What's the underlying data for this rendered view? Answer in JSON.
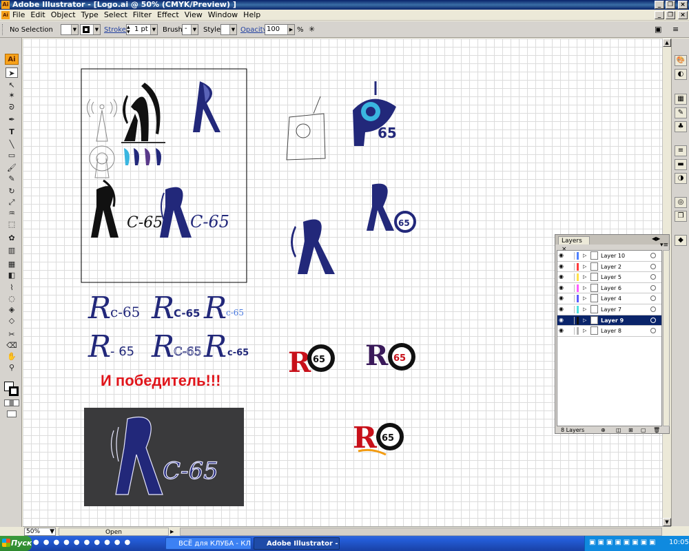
{
  "window": {
    "title": "Adobe Illustrator - [Logo.ai @ 50% (CMYK/Preview) ]",
    "app_icon": "Ai",
    "doc_icon": "Ai"
  },
  "menu": [
    "File",
    "Edit",
    "Object",
    "Type",
    "Select",
    "Filter",
    "Effect",
    "View",
    "Window",
    "Help"
  ],
  "control_bar": {
    "selection": "No Selection",
    "stroke_label": "Stroke:",
    "stroke_value": "1 pt",
    "brush_label": "Brush:",
    "brush_value": "-",
    "style_label": "Style:",
    "opacity_label": "Opacity:",
    "opacity_value": "100",
    "opacity_unit": "%"
  },
  "tools": {
    "badge": "Ai",
    "icons": [
      "selection-tool",
      "direct-selection-tool",
      "magic-wand-tool",
      "lasso-tool",
      "pen-tool",
      "type-tool",
      "line-tool",
      "rectangle-tool",
      "paintbrush-tool",
      "pencil-tool",
      "rotate-tool",
      "scale-tool",
      "warp-tool",
      "free-transform-tool",
      "symbol-sprayer-tool",
      "column-graph-tool",
      "mesh-tool",
      "gradient-tool",
      "eyedropper-tool",
      "blend-tool",
      "live-paint-tool",
      "live-paint-selection-tool",
      "slice-tool",
      "eraser-tool",
      "scissors-tool",
      "hand-tool",
      "zoom-tool"
    ]
  },
  "artwork": {
    "caption": "И победитель!!!",
    "caption_color": "#e0151b",
    "logo_text_a": "C-65",
    "logo_text_b": "C-65",
    "logo_text_c": "c-65",
    "logo_text_d": "c-65",
    "logo_text_e": "C-65",
    "logo_text_f": "c-65",
    "logo_text_g": "c-65",
    "logo_text_h": "- 65",
    "logo_text_i": "c-65",
    "logo_text_j": "c-65",
    "logo_text_k": "C-65",
    "badge_num": "65",
    "badge_num_2": "65",
    "badge_num_3": "65",
    "badge_num_4": "65",
    "badge_num_5": "65",
    "badge_num_6": "65",
    "dark_logo_text": "C-65",
    "navy": "#22287a",
    "dark_bg": "#3a3a3c"
  },
  "layers_panel": {
    "tab": "Layers",
    "layers": [
      {
        "name": "Layer 10",
        "color": "#4f81ff"
      },
      {
        "name": "Layer 2",
        "color": "#ff3b3b"
      },
      {
        "name": "Layer 5",
        "color": "#ffe14a"
      },
      {
        "name": "Layer 6",
        "color": "#ff5cff"
      },
      {
        "name": "Layer 4",
        "color": "#5a5aff"
      },
      {
        "name": "Layer 7",
        "color": "#4fe0e0"
      },
      {
        "name": "Layer 9",
        "color": "#111111",
        "selected": true
      },
      {
        "name": "Layer 8",
        "color": "#b0b0b0"
      }
    ],
    "count": "8 Layers"
  },
  "status": {
    "zoom": "50%",
    "info": "Open"
  },
  "taskbar": {
    "start": "Пуск",
    "tasks": [
      "ВСЁ для КЛУБА - КЛУБ ...",
      "Adobe Illustrator - [L..."
    ],
    "clock": "10:05"
  }
}
